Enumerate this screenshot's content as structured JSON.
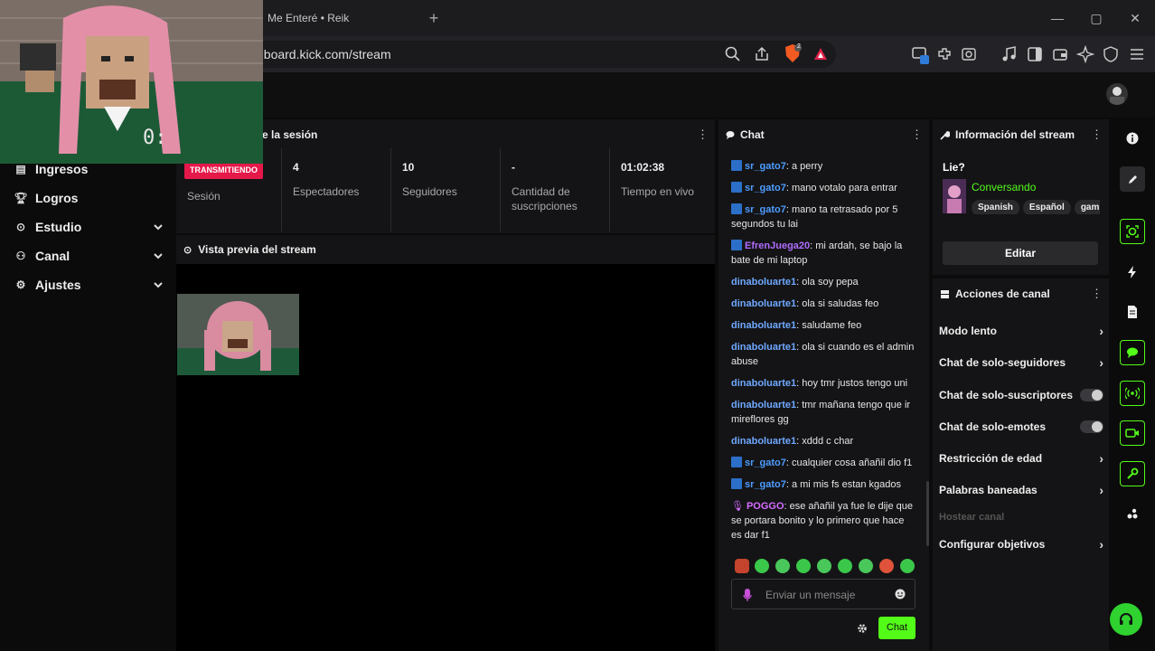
{
  "browser": {
    "tab_title": "Me Enteré • Reik",
    "new_tab": "+",
    "url": "hboard.kick.com/stream",
    "shield_count": "2",
    "window_controls": {
      "minimize": "—",
      "maximize": "▢",
      "close": "✕"
    }
  },
  "sidebar": {
    "items": [
      {
        "label": "Ingresos",
        "icon": "revenue-icon"
      },
      {
        "label": "Logros",
        "icon": "trophy-icon"
      },
      {
        "label": "Estudio",
        "icon": "studio-icon",
        "chevron": "⌄"
      },
      {
        "label": "Canal",
        "icon": "channel-icon",
        "chevron": "⌄"
      },
      {
        "label": "Ajustes",
        "icon": "gear-icon",
        "chevron": "⌄"
      }
    ]
  },
  "session": {
    "title": "e la sesión",
    "badge": "TRANSMITIENDO",
    "stats": [
      {
        "value": "",
        "label": "Sesión"
      },
      {
        "value": "4",
        "label": "Espectadores"
      },
      {
        "value": "10",
        "label": "Seguidores"
      },
      {
        "value": "-",
        "label": "Cantidad de suscripciones"
      },
      {
        "value": "01:02:38",
        "label": "Tiempo en vivo"
      }
    ]
  },
  "preview": {
    "title": "Vista previa del stream"
  },
  "webcam_overlay_text": "0:",
  "chat": {
    "title": "Chat",
    "messages": [
      {
        "user": "sr_gato7",
        "text": ": a perry",
        "color": "#4d9cff",
        "badge": true
      },
      {
        "user": "sr_gato7",
        "text": ": mano votalo para entrar",
        "color": "#4d9cff",
        "badge": true
      },
      {
        "user": "sr_gato7",
        "text": ": mano ta retrasado por 5 segundos tu lai",
        "color": "#4d9cff",
        "badge": true
      },
      {
        "user": "EfrenJuega20",
        "text": ": mi ardah, se bajo la bate de mi laptop",
        "color": "#b06cff",
        "badge": true
      },
      {
        "user": "dinaboluarte1",
        "text": ": ola soy pepa",
        "color": "#6fa8ff",
        "badge": false
      },
      {
        "user": "dinaboluarte1",
        "text": ": ola si saludas feo",
        "color": "#6fa8ff",
        "badge": false
      },
      {
        "user": "dinaboluarte1",
        "text": ": saludame feo",
        "color": "#6fa8ff",
        "badge": false
      },
      {
        "user": "dinaboluarte1",
        "text": ": ola si cuando es el admin abuse",
        "color": "#6fa8ff",
        "badge": false
      },
      {
        "user": "dinaboluarte1",
        "text": ": hoy tmr justos tengo uni",
        "color": "#6fa8ff",
        "badge": false
      },
      {
        "user": "dinaboluarte1",
        "text": ": tmr mañana tengo que ir mireflores gg",
        "color": "#6fa8ff",
        "badge": false
      },
      {
        "user": "dinaboluarte1",
        "text": ": xddd c char",
        "color": "#6fa8ff",
        "badge": false
      },
      {
        "user": "sr_gato7",
        "text": ": cualquier cosa añañil dio f1",
        "color": "#4d9cff",
        "badge": true
      },
      {
        "user": "sr_gato7",
        "text": ": a mi mis fs estan kgados",
        "color": "#4d9cff",
        "badge": true
      },
      {
        "user": "POGGO",
        "text": ": ese añañil ya fue le dije que se portara bonito y lo primero que hace es dar f1",
        "color": "#d46bff",
        "badge": false
      }
    ],
    "input_placeholder": "Enviar un mensaje",
    "send_label": "Chat"
  },
  "stream_info": {
    "title": "Información del stream",
    "stream_title": "Lie?",
    "category": "Conversando",
    "tags": [
      "Spanish",
      "Español",
      "gaming"
    ],
    "edit_label": "Editar"
  },
  "channel_actions": {
    "title": "Acciones de canal",
    "rows": [
      {
        "label": "Modo lento",
        "control": "chevron"
      },
      {
        "label": "Chat de solo-seguidores",
        "control": "chevron"
      },
      {
        "label": "Chat de solo-suscriptores",
        "control": "toggle"
      },
      {
        "label": "Chat de solo-emotes",
        "control": "toggle"
      },
      {
        "label": "Restricción de edad",
        "control": "chevron"
      },
      {
        "label": "Palabras baneadas",
        "control": "chevron"
      },
      {
        "label": "Hostear canal",
        "control": "disabled"
      },
      {
        "label": "Configurar objetivos",
        "control": "chevron"
      }
    ]
  },
  "colors": {
    "accent": "#53fc18",
    "live": "#e5184a",
    "bg": "#0b0b0b",
    "panel": "#141416"
  }
}
